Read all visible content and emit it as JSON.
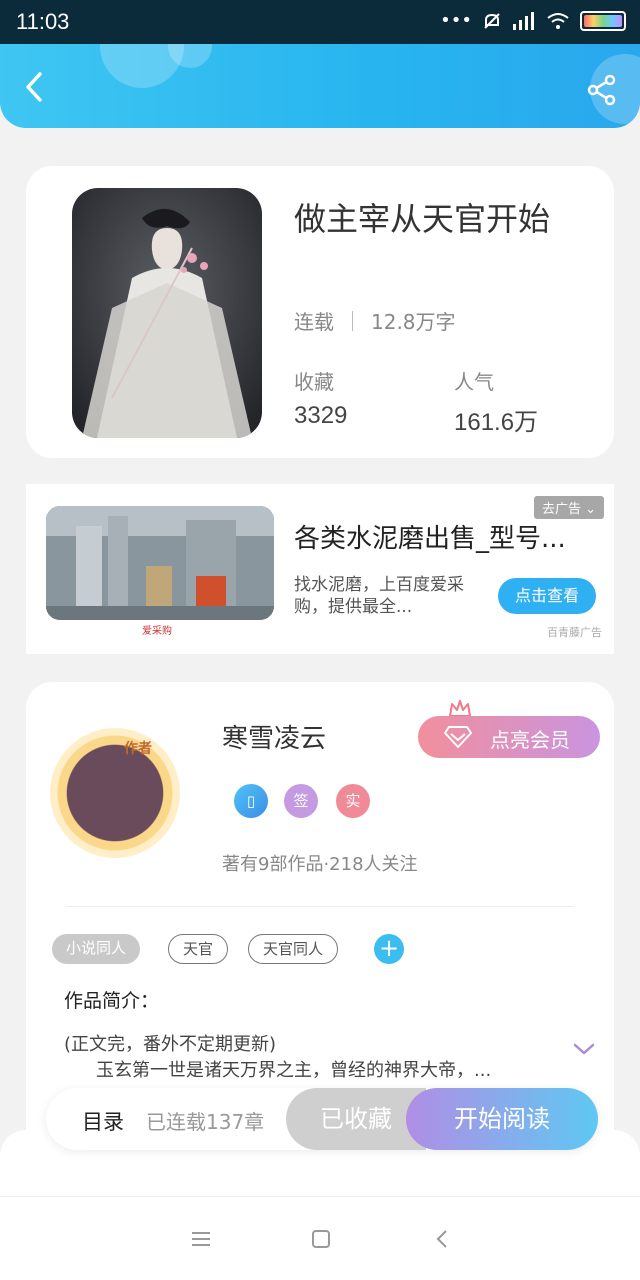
{
  "status_bar": {
    "time": "11:03",
    "icons": [
      "dots-icon",
      "mute-icon",
      "signal-icon",
      "wifi-icon",
      "battery-icon"
    ]
  },
  "header": {
    "back_icon": "chevron-left-icon",
    "share_icon": "share-icon",
    "color": "#27b4ef"
  },
  "book": {
    "title": "做主宰从天官开始",
    "status": "连载",
    "word_count": "12.8万字",
    "favorites_label": "收藏",
    "favorites_value": "3329",
    "popularity_label": "人气",
    "popularity_value": "161.6万"
  },
  "ad": {
    "title": "各类水泥磨出售_型号...",
    "description": "找水泥磨，上百度爱采购，提供最全...",
    "close_label": "去广告",
    "cta_label": "点击查看",
    "source": "百青藤广告",
    "brand": "爱采购"
  },
  "author": {
    "avatar_tag": "作者",
    "name": "寒雪凌云",
    "vip_label": "点亮会员",
    "badges": [
      "签",
      "实"
    ],
    "meta": "著有9部作品·218人关注"
  },
  "tags": [
    "小说同人",
    "天官",
    "天官同人"
  ],
  "intro": {
    "label": "作品简介：",
    "line1": "(正文完，番外不定期更新)",
    "line2": "玉玄第一世是诸天万界之主，曾经的神界大帝，..."
  },
  "action_bar": {
    "toc_label": "目录",
    "toc_count": "已连载137章",
    "collected_label": "已收藏",
    "read_label": "开始阅读"
  },
  "navbar": {
    "icons": [
      "menu-icon",
      "home-square-icon",
      "back-triangle-icon"
    ]
  }
}
